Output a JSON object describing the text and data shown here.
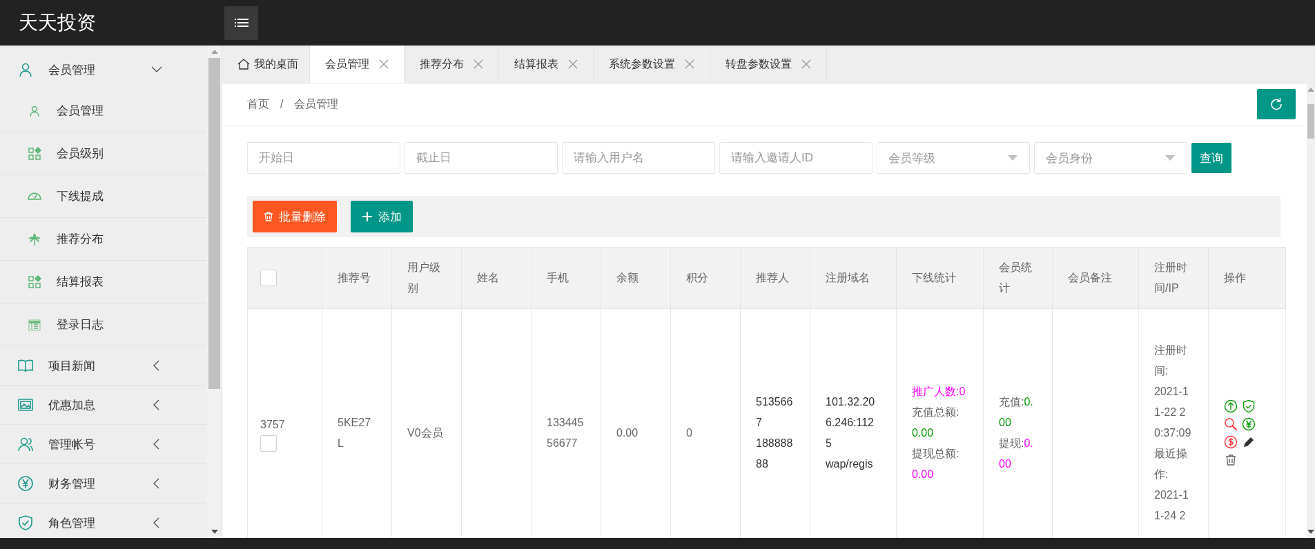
{
  "header": {
    "logo": "天天投资"
  },
  "sidebar": {
    "groups": [
      {
        "label": "会员管理",
        "expanded": true,
        "children": [
          {
            "label": "会员管理"
          },
          {
            "label": "会员级别"
          },
          {
            "label": "下线提成"
          },
          {
            "label": "推荐分布"
          },
          {
            "label": "结算报表"
          },
          {
            "label": "登录日志"
          }
        ]
      },
      {
        "label": "项目新闻",
        "expanded": false
      },
      {
        "label": "优惠加息",
        "expanded": false
      },
      {
        "label": "管理帐号",
        "expanded": false
      },
      {
        "label": "财务管理",
        "expanded": false
      },
      {
        "label": "角色管理",
        "expanded": false
      }
    ]
  },
  "tabs": [
    {
      "label": "我的桌面",
      "kind": "home",
      "selected": false
    },
    {
      "label": "会员管理",
      "kind": "closable",
      "selected": true
    },
    {
      "label": "推荐分布",
      "kind": "closable",
      "selected": false
    },
    {
      "label": "结算报表",
      "kind": "closable",
      "selected": false
    },
    {
      "label": "系统参数设置",
      "kind": "closable",
      "selected": false
    },
    {
      "label": "转盘参数设置",
      "kind": "closable",
      "selected": false
    }
  ],
  "breadcrumb": {
    "items": [
      "首页",
      "会员管理"
    ],
    "separator": "/"
  },
  "filters": [
    {
      "kind": "input",
      "placeholder": "开始日"
    },
    {
      "kind": "input",
      "placeholder": "截止日"
    },
    {
      "kind": "input",
      "placeholder": "请输入用户名"
    },
    {
      "kind": "input",
      "placeholder": "请输入邀请人ID"
    },
    {
      "kind": "select",
      "placeholder": "会员等级"
    },
    {
      "kind": "select",
      "placeholder": "会员身份"
    }
  ],
  "search_button": "查询",
  "actions": [
    {
      "label": "批量删除",
      "kind": "danger"
    },
    {
      "label": "添加",
      "kind": "add"
    }
  ],
  "table": {
    "header_checkbox": {
      "checked": false
    },
    "columns": [
      "推荐号",
      "用户级别",
      "姓名",
      "手机",
      "余额",
      "积分",
      "推荐人",
      "注册域名",
      "下线统计",
      "会员统计",
      "会员备注",
      "注册时间/IP",
      "操作"
    ],
    "rows": [
      {
        "id": "3757",
        "checked": false,
        "code": "5KE27L",
        "level": "V0会员",
        "phone": "13344556677",
        "balance": "0.00",
        "points": "0",
        "referrer": [
          "5135667",
          "18888888"
        ],
        "domain": [
          "101.32.206.246:1125",
          "wap/regis"
        ],
        "downline": [
          {
            "kind": "highlight",
            "label": "推广人数:",
            "value": "0",
            "color": "#ff00ff"
          },
          {
            "kind": "plain",
            "label": "充值总额:",
            "value": "0.00",
            "color": "#009900"
          },
          {
            "kind": "plain",
            "label": "提现总额:",
            "value": "0.00",
            "color": "#ff00ff"
          }
        ],
        "member_stats": [
          {
            "label": "充值:",
            "value": "0.00",
            "color": "#009900"
          },
          {
            "label": "提现:",
            "value": "0.00",
            "color": "#ff00ff"
          }
        ],
        "times": [
          "注册时间:",
          "2021-11-22 20:37:09",
          "最近操作:",
          "2021-11-24 2"
        ]
      }
    ]
  }
}
